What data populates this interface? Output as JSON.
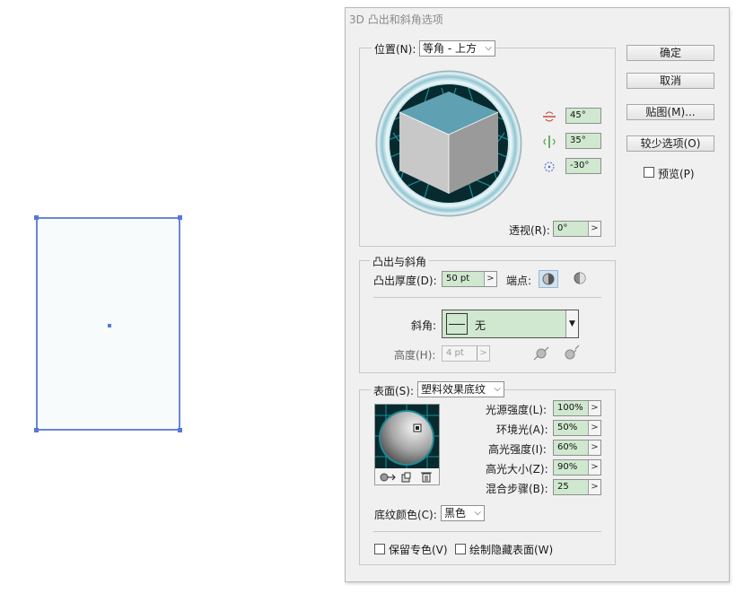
{
  "dialog": {
    "title": "3D 凸出和斜角选项"
  },
  "buttons": {
    "ok": "确定",
    "cancel": "取消",
    "map": "贴图(M)...",
    "fewer": "较少选项(O)"
  },
  "preview": {
    "label": "预览(P)",
    "checked": false
  },
  "position": {
    "legend": "位置(N):",
    "preset": "等角 - 上方",
    "rot_x": "45°",
    "rot_y": "35°",
    "rot_z": "-30°",
    "perspective_label": "透视(R):",
    "perspective": "0°"
  },
  "extrude": {
    "legend": "凸出与斜角",
    "depth_label": "凸出厚度(D):",
    "depth": "50 pt",
    "cap_label": "端点:",
    "bevel_label": "斜角:",
    "bevel": "无",
    "height_label": "高度(H):",
    "height": "4 pt"
  },
  "surface": {
    "legend": "表面(S):",
    "type": "塑料效果底纹",
    "light_intensity_label": "光源强度(L):",
    "light_intensity": "100%",
    "ambient_label": "环境光(A):",
    "ambient": "50%",
    "highlight_intensity_label": "高光强度(I):",
    "highlight_intensity": "60%",
    "highlight_size_label": "高光大小(Z):",
    "highlight_size": "90%",
    "blend_steps_label": "混合步骤(B):",
    "blend_steps": "25",
    "shade_color_label": "底纹颜色(C):",
    "shade_color": "黑色",
    "preserve_spot_label": "保留专色(V)",
    "draw_hidden_label": "绘制隐藏表面(W)"
  }
}
